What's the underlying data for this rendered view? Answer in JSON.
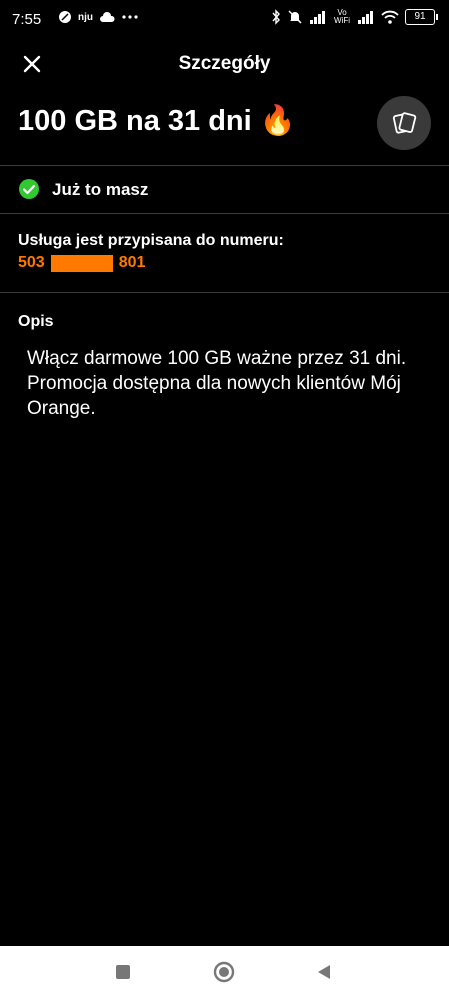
{
  "status_bar": {
    "time": "7:55",
    "battery": "91",
    "icons": [
      "whatsapp-icon",
      "nju-icon",
      "cloud-icon",
      "more-dots-icon",
      "bluetooth-icon",
      "mute-icon",
      "signal-icon",
      "vowifi-icon",
      "signal-icon",
      "wifi-icon",
      "battery-icon"
    ],
    "nju_label": "nju",
    "vowifi_label": "Vo WiFi"
  },
  "header": {
    "title": "Szczegóły"
  },
  "offer": {
    "title": "100 GB na 31 dni 🔥"
  },
  "status": {
    "owned_label": "Już to masz"
  },
  "assignment": {
    "label": "Usługa jest przypisana do numeru:",
    "number_prefix": "503",
    "number_suffix": "801"
  },
  "description": {
    "heading": "Opis",
    "text": "Włącz darmowe 100 GB ważne przez 31 dni. Promocja dostępna dla nowych klientów Mój Orange."
  },
  "colors": {
    "accent": "#ff7900",
    "success": "#32c832",
    "background": "#000000"
  }
}
